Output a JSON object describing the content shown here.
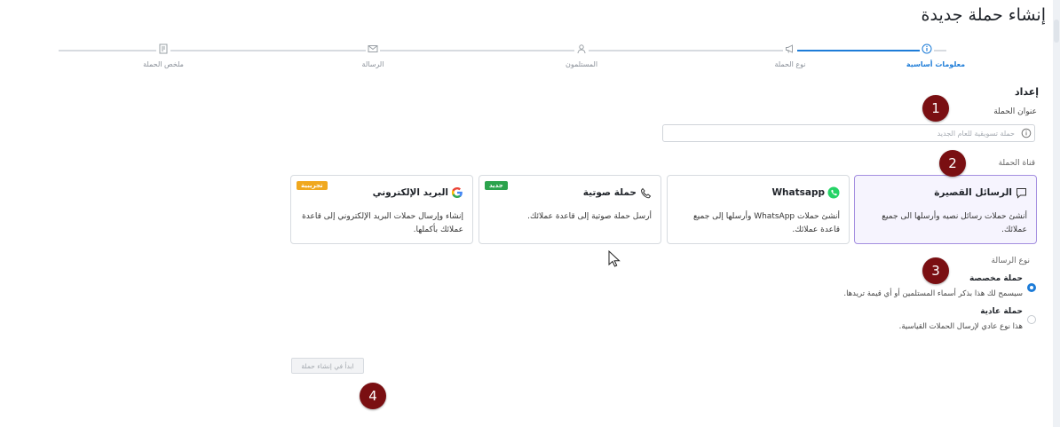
{
  "page": {
    "title": "إنشاء حملة جديدة"
  },
  "colors": {
    "primary": "#1d7cd8",
    "selected_card_border": "#a48fe0",
    "marker": "#7a0f12",
    "badge_new": "#2ca34d",
    "badge_trial": "#f0a81e"
  },
  "stepper": {
    "steps": [
      {
        "label": "معلومات أساسية",
        "icon": "info-circle-icon",
        "active": true
      },
      {
        "label": "نوع الحملة",
        "icon": "megaphone-icon",
        "active": false
      },
      {
        "label": "المستلمون",
        "icon": "user-icon",
        "active": false
      },
      {
        "label": "الرسالة",
        "icon": "envelope-icon",
        "active": false
      },
      {
        "label": "ملخص الحملة",
        "icon": "summary-icon",
        "active": false
      }
    ]
  },
  "setup": {
    "section_title": "إعداد",
    "campaign_title_label": "عنوان الحملة",
    "campaign_title_placeholder": "حملة تسويقية للعام الجديد",
    "channel_label": "قناة الحملة",
    "channels": [
      {
        "title": "الرسائل القصيرة",
        "icon": "chat-bubble-icon",
        "description": "أنشئ حملات رسائل نصيه وأرسلها الى جميع عملائك.",
        "selected": true,
        "badge": ""
      },
      {
        "title": "Whatsapp",
        "icon": "whatsapp-icon",
        "description": "أنشئ حملات WhatsApp وأرسلها إلى جميع قاعدة عملائك.",
        "selected": false,
        "badge": ""
      },
      {
        "title": "حملة صوتية",
        "icon": "phone-icon",
        "description": "أرسل حملة صوتية إلى قاعدة عملائك.",
        "selected": false,
        "badge": "جديد"
      },
      {
        "title": "البريد الإلكتروني",
        "icon": "google-icon",
        "description": "إنشاء وإرسال حملات البريد الإلكتروني إلى قاعدة عملائك بأكملها.",
        "selected": false,
        "badge": "تجريبية"
      }
    ],
    "message_type_label": "نوع الرسالة",
    "message_types": [
      {
        "title": "حملة مخصصة",
        "description": "سيسمح لك هذا بذكر أسماء المستلمين أو أي قيمة تريدها.",
        "selected": true
      },
      {
        "title": "حملة عادية",
        "description": "هذا نوع عادي لإرسال الحملات القياسية.",
        "selected": false
      }
    ],
    "start_button": "ابدأ في إنشاء حملة"
  },
  "markers": [
    "1",
    "2",
    "3",
    "4"
  ]
}
